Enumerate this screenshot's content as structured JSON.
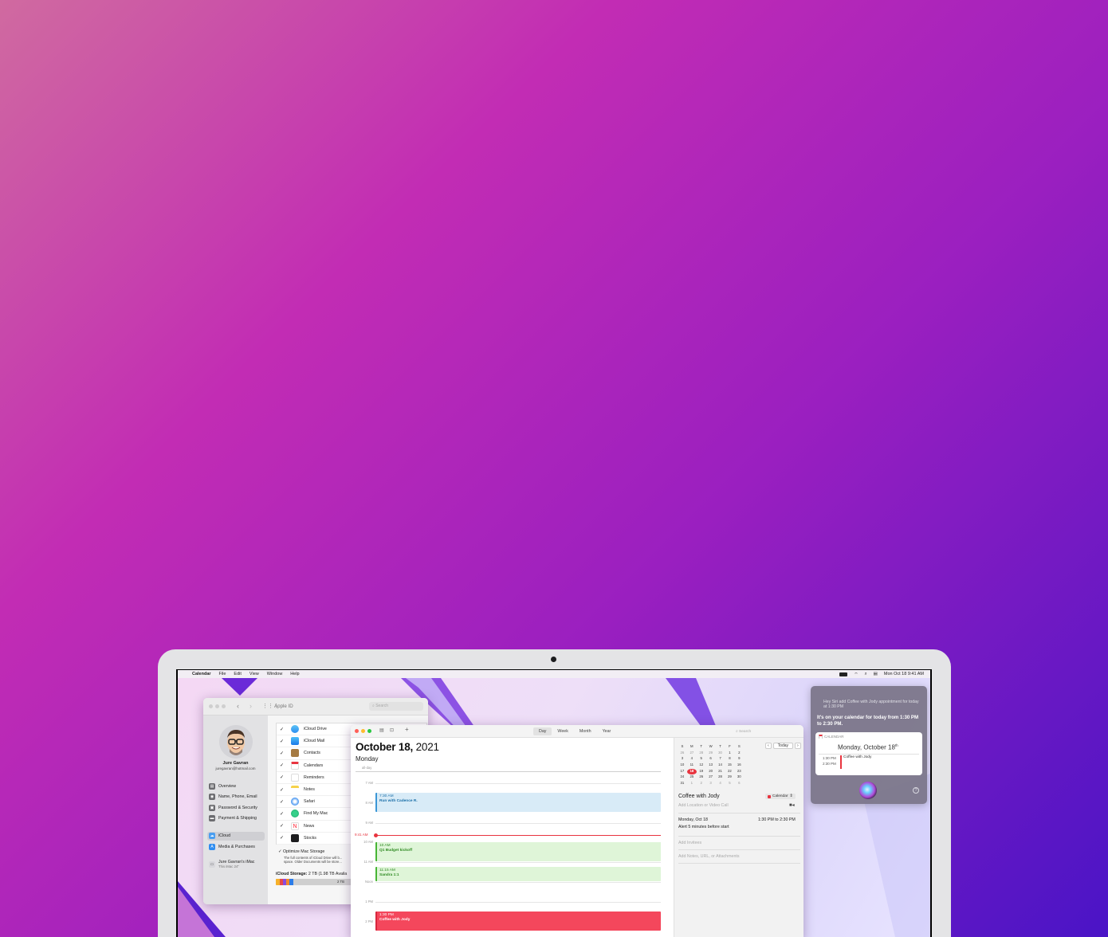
{
  "menubar": {
    "app": "Calendar",
    "items": [
      "File",
      "Edit",
      "View",
      "Window",
      "Help"
    ],
    "datetime": "Mon Oct 18  9:41 AM"
  },
  "apple_id": {
    "title": "Apple ID",
    "search_placeholder": "Search",
    "user_name": "Jure Gavran",
    "user_email": "juregavran@hotmail.com",
    "nav": [
      "Overview",
      "Name, Phone, Email",
      "Password & Security",
      "Payment & Shipping"
    ],
    "nav2": [
      "iCloud",
      "Media & Purchases"
    ],
    "device_name": "Jure Gavran's iMac",
    "device_sub": "This iMac 24\"",
    "apps": [
      "iCloud Drive",
      "iCloud Mail",
      "Contacts",
      "Calendars",
      "Reminders",
      "Notes",
      "Safari",
      "Find My Mac",
      "News",
      "Stocks"
    ],
    "optimize_label": "Optimize Mac Storage",
    "optimize_desc": "The full contents of iCloud Drive will b... space. Older Documents will be store...",
    "storage_label": "iCloud Storage:",
    "storage_value": "2 TB (1.98 TB Availa",
    "storage_bar_text": "2 TB"
  },
  "calendar": {
    "tabs": [
      "Day",
      "Week",
      "Month",
      "Year"
    ],
    "active_tab": "Day",
    "search_placeholder": "Search",
    "date_bold": "October 18,",
    "date_year": " 2021",
    "weekday": "Monday",
    "all_day": "all-day",
    "hours": [
      "7 AM",
      "8 AM",
      "9 AM",
      "10 AM",
      "11 AM",
      "Noon",
      "1 PM",
      "2 PM"
    ],
    "now_label": "9:41 AM",
    "events": [
      {
        "time": "7:30 AM",
        "title": "Run with Cadence R."
      },
      {
        "time": "10 AM",
        "title": "Q1 Budget kickoff"
      },
      {
        "time": "11:15 AM",
        "title": "Sandra 1:1"
      },
      {
        "time": "1:30 PM",
        "title": "Coffee with Jody"
      }
    ],
    "mini_cal": {
      "days_header": [
        "S",
        "M",
        "T",
        "W",
        "T",
        "F",
        "S"
      ],
      "weeks": [
        [
          "26",
          "27",
          "28",
          "29",
          "30",
          "1",
          "2"
        ],
        [
          "3",
          "4",
          "5",
          "6",
          "7",
          "8",
          "9"
        ],
        [
          "10",
          "11",
          "12",
          "13",
          "14",
          "15",
          "16"
        ],
        [
          "17",
          "18",
          "19",
          "20",
          "21",
          "22",
          "23"
        ],
        [
          "24",
          "25",
          "26",
          "27",
          "28",
          "29",
          "30"
        ],
        [
          "31",
          "1",
          "2",
          "3",
          "4",
          "5",
          "6"
        ]
      ],
      "today_label": "Today",
      "selected": "18"
    },
    "detail": {
      "title": "Coffee with Jody",
      "calendar_tag": "Calendar",
      "location_placeholder": "Add Location or Video Call",
      "date": "Monday, Oct 18",
      "time_range": "1:30 PM to 2:30 PM",
      "alert": "Alert 5 minutes before start",
      "invitees": "Add Invitees",
      "notes": "Add Notes, URL, or Attachments"
    }
  },
  "siri": {
    "query": "Hey Siri add Coffee with Jody appointment for today at 1:30 PM",
    "answer": "It's on your calendar for today from 1:30 PM to 2:30 PM.",
    "card_label": "CALENDAR",
    "card_date": "Monday, October 18",
    "card_date_sup": "th",
    "card_time_start": "1:30 PM",
    "card_time_end": "2:30 PM",
    "card_event": "Coffee with Jody"
  },
  "colors": {
    "blue_event": "#d8ebf7",
    "green_event": "#dff5d8",
    "red_event": "#f4475c",
    "now_line": "#e8343f"
  }
}
